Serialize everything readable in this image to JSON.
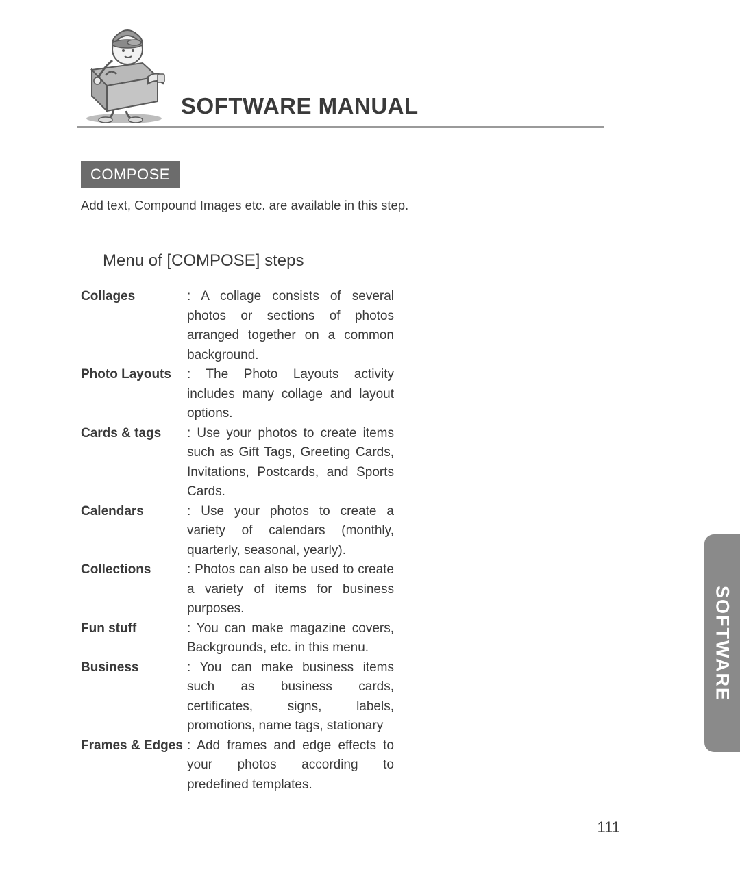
{
  "header": {
    "title": "SOFTWARE MANUAL"
  },
  "section": {
    "badge": "COMPOSE",
    "subtitle": "Add text, Compound Images etc. are available in this step.",
    "steps_title": "Menu of [COMPOSE] steps"
  },
  "definitions": [
    {
      "term": "Collages",
      "desc": ": A collage consists of several photos or sections of photos arranged together on a common background."
    },
    {
      "term": "Photo Layouts",
      "desc": ": The Photo Layouts activity includes many collage and layout options."
    },
    {
      "term": "Cards & tags",
      "desc": ": Use your photos to create items such as Gift Tags, Greeting Cards, Invitations, Postcards, and Sports Cards."
    },
    {
      "term": "Calendars",
      "desc": ": Use your photos to create a variety of calendars (monthly, quarterly, seasonal, yearly)."
    },
    {
      "term": "Collections",
      "desc": ": Photos can also be used to create a variety of items for business purposes."
    },
    {
      "term": "Fun stuff",
      "desc": ": You can make magazine covers, Backgrounds, etc. in this menu."
    },
    {
      "term": "Business",
      "desc": ": You can make business items such as business cards, certificates, signs, labels, promotions, name tags, stationary"
    },
    {
      "term": "Frames & Edges",
      "desc": ": Add frames and edge effects to your photos according to predefined templates."
    }
  ],
  "side_tab": "SOFTWARE",
  "page_number": "111"
}
